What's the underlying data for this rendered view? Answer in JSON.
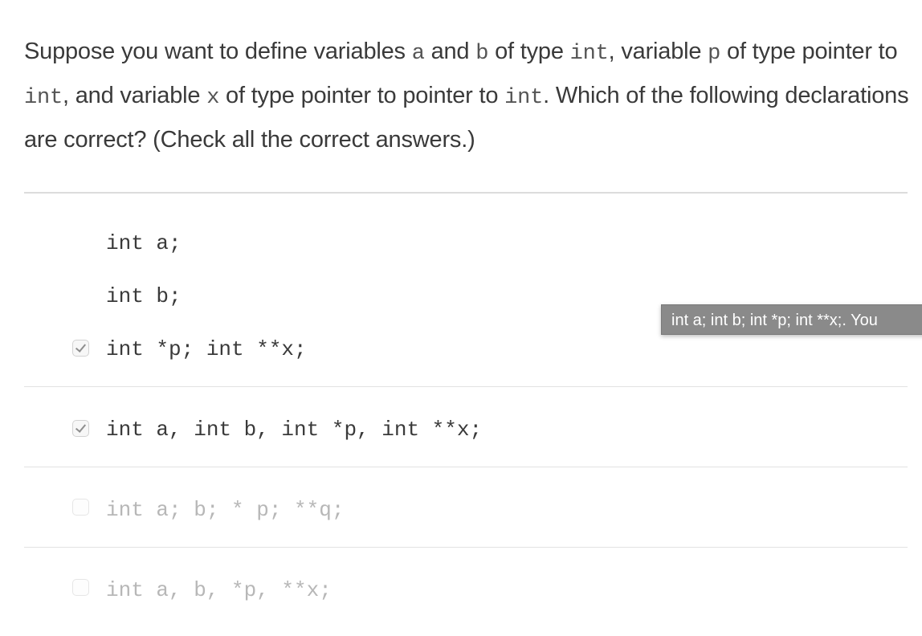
{
  "question": {
    "parts": [
      {
        "type": "text",
        "value": "Suppose you want to define variables "
      },
      {
        "type": "code",
        "value": "a"
      },
      {
        "type": "text",
        "value": " and "
      },
      {
        "type": "code",
        "value": "b"
      },
      {
        "type": "text",
        "value": " of type "
      },
      {
        "type": "code",
        "value": "int"
      },
      {
        "type": "text",
        "value": ", variable "
      },
      {
        "type": "code",
        "value": "p"
      },
      {
        "type": "text",
        "value": " of type pointer to "
      },
      {
        "type": "code",
        "value": "int"
      },
      {
        "type": "text",
        "value": ", and variable "
      },
      {
        "type": "code",
        "value": "x"
      },
      {
        "type": "text",
        "value": " of type pointer to pointer to "
      },
      {
        "type": "code",
        "value": "int"
      },
      {
        "type": "text",
        "value": ".  Which of the following declarations are correct? (Check all the correct answers.)"
      }
    ]
  },
  "options": [
    {
      "checked": true,
      "lines": [
        "int a;",
        "int b;",
        "int *p; int **x;"
      ],
      "dimmed": false
    },
    {
      "checked": true,
      "lines": [
        "int a, int b, int *p, int **x;"
      ],
      "dimmed": false
    },
    {
      "checked": false,
      "lines": [
        "int a; b; * p; **q;"
      ],
      "dimmed": true
    },
    {
      "checked": false,
      "lines": [
        "int a, b, *p, **x;"
      ],
      "dimmed": true
    }
  ],
  "tooltip": {
    "text": "int a; int b; int *p; int **x;. You"
  }
}
